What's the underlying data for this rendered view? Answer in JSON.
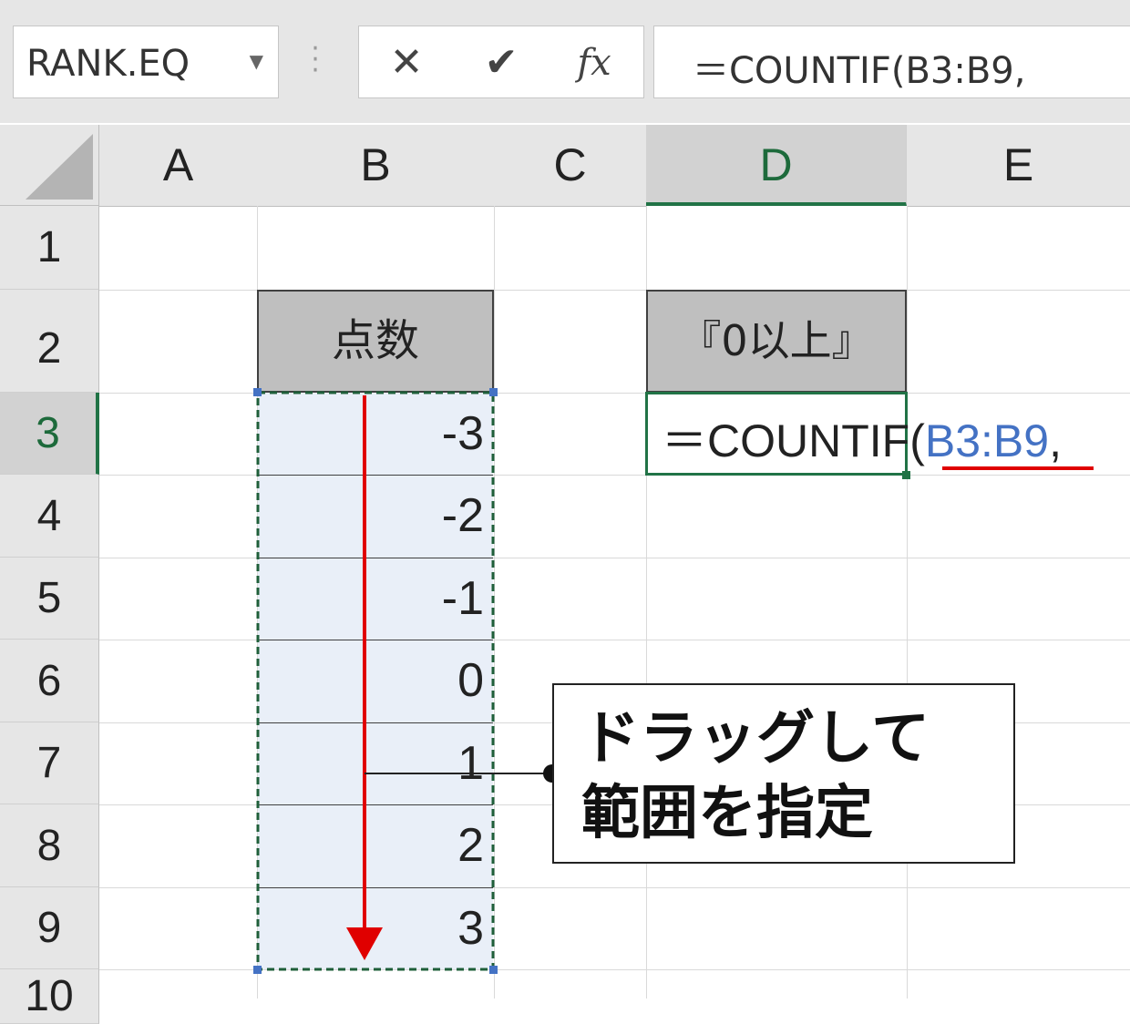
{
  "formula_bar": {
    "name_box": "RANK.EQ",
    "cancel_glyph": "✕",
    "enter_glyph": "✔",
    "fx_label": "fx",
    "formula": "＝COUNTIF(B3:B9,"
  },
  "columns": [
    "A",
    "B",
    "C",
    "D",
    "E"
  ],
  "rows": [
    "1",
    "2",
    "3",
    "4",
    "5",
    "6",
    "7",
    "8",
    "9",
    "10"
  ],
  "cells": {
    "B2": "点数",
    "D2": "『0以上』",
    "D3_prefix": "＝COUNTIF(",
    "D3_ref": "B3:B9",
    "D3_suffix": ",",
    "B_values": [
      "-3",
      "-2",
      "-1",
      "0",
      "1",
      "2",
      "3"
    ]
  },
  "callout": {
    "line1": "ドラッグして",
    "line2": "範囲を指定"
  },
  "colors": {
    "selection_green": "#217346",
    "range_blue": "#4472c4",
    "arrow_red": "#e00000"
  }
}
